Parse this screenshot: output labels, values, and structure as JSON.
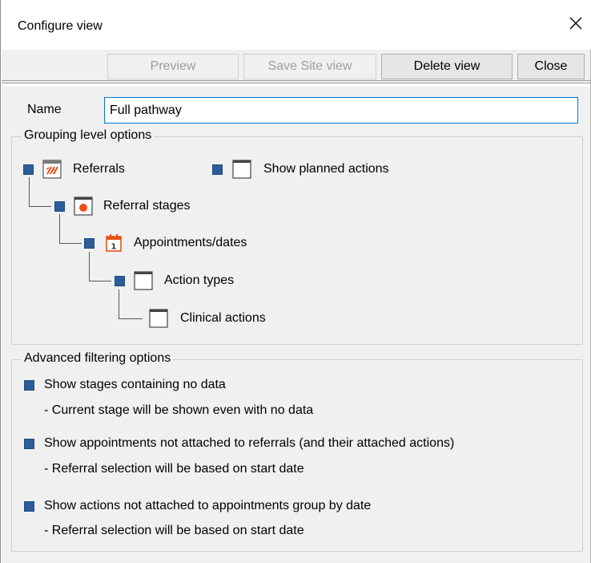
{
  "window": {
    "title": "Configure view"
  },
  "toolbar": {
    "preview": "Preview",
    "save_site_view": "Save Site view",
    "delete_view": "Delete view",
    "close": "Close"
  },
  "name_field": {
    "label": "Name",
    "value": "Full pathway"
  },
  "grouping": {
    "legend": "Grouping level options",
    "referrals": "Referrals",
    "show_planned": "Show planned actions",
    "referral_stages": "Referral stages",
    "appointments": "Appointments/dates",
    "action_types": "Action types",
    "clinical_actions": "Clinical actions"
  },
  "filtering": {
    "legend": "Advanced filtering options",
    "opt1": "Show stages containing no data",
    "opt1_note": "- Current stage will be shown even with no data",
    "opt2": "Show appointments not attached to referrals (and their attached actions)",
    "opt2_note": "- Referral selection will be based on start date",
    "opt3": "Show actions not attached to appointments group by date",
    "opt3_note": "- Referral selection will be based on start date"
  },
  "colors": {
    "checkbox": "#2c5d9a",
    "accent_orange": "#e8501a",
    "focus_border": "#0078d7"
  }
}
